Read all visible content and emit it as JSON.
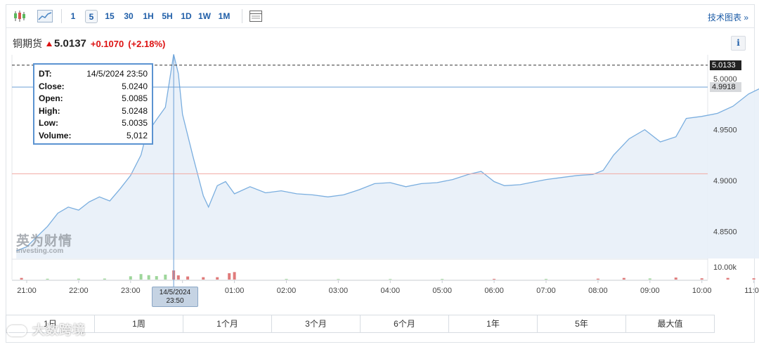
{
  "toolbar": {
    "intervals": [
      "1",
      "5",
      "15",
      "30",
      "1H",
      "5H",
      "1D",
      "1W",
      "1M"
    ],
    "active_interval": "5",
    "tech_chart_label": "技术图表 »"
  },
  "quote": {
    "name": "铜期货",
    "price": "5.0137",
    "change": "+0.1070",
    "change_pct": "(+2.18%)"
  },
  "info_label": "i",
  "brand": {
    "cn": "英为财情",
    "en": "Investing.com"
  },
  "tooltip": {
    "rows": [
      {
        "k": "DT:",
        "v": "14/5/2024 23:50"
      },
      {
        "k": "Close:",
        "v": "5.0240"
      },
      {
        "k": "Open:",
        "v": "5.0085"
      },
      {
        "k": "High:",
        "v": "5.0248"
      },
      {
        "k": "Low:",
        "v": "5.0035"
      },
      {
        "k": "Volume:",
        "v": "5,012"
      }
    ]
  },
  "crosshair_time": {
    "date": "14/5/2024",
    "time": "23:50"
  },
  "price_flags": {
    "last": "5.0133",
    "cursor": "4.9918"
  },
  "ranges": [
    "1日",
    "1周",
    "1个月",
    "3个月",
    "6个月",
    "1年",
    "5年",
    "最大值"
  ],
  "watermark": "大数跨境",
  "colors": {
    "line": "#7aaedf",
    "area": "#e8f0f8",
    "up_volume": "#e07b7b",
    "down_volume": "#9ed69b",
    "accent": "#1f5ea8",
    "negative": "#d11111"
  },
  "chart_data": {
    "type": "area",
    "title": "",
    "xlabel": "",
    "ylabel": "",
    "x_ticks": [
      "21:00",
      "22:00",
      "23:00",
      "00:00",
      "01:00",
      "02:00",
      "03:00",
      "04:00",
      "05:00",
      "06:00",
      "07:00",
      "08:00",
      "09:00",
      "10:00",
      "11:00"
    ],
    "y_ticks": [
      "4.8500",
      "4.9000",
      "4.9500",
      "5.0000"
    ],
    "ylim": [
      4.8235,
      5.0235
    ],
    "volume_axis_label": "10.00k",
    "volume_max": 10000,
    "reference_lines": {
      "last_price": 5.0133,
      "cursor_price": 4.9918,
      "previous_close": 4.9067
    },
    "series": [
      {
        "points": [
          [
            20.8,
            4.831
          ],
          [
            21.0,
            4.835
          ],
          [
            21.2,
            4.845
          ],
          [
            21.4,
            4.855
          ],
          [
            21.6,
            4.868
          ],
          [
            21.8,
            4.874
          ],
          [
            22.0,
            4.871
          ],
          [
            22.2,
            4.879
          ],
          [
            22.4,
            4.884
          ],
          [
            22.6,
            4.88
          ],
          [
            22.8,
            4.892
          ],
          [
            23.0,
            4.905
          ],
          [
            23.2,
            4.925
          ],
          [
            23.3,
            4.945
          ],
          [
            23.5,
            4.96
          ],
          [
            23.67,
            4.972
          ],
          [
            23.83,
            5.024
          ],
          [
            23.92,
            5.005
          ],
          [
            24.0,
            4.965
          ],
          [
            24.2,
            4.924
          ],
          [
            24.4,
            4.885
          ],
          [
            24.5,
            4.874
          ],
          [
            24.67,
            4.895
          ],
          [
            24.83,
            4.899
          ],
          [
            25.0,
            4.887
          ],
          [
            25.3,
            4.894
          ],
          [
            25.6,
            4.888
          ],
          [
            25.9,
            4.89
          ],
          [
            26.2,
            4.887
          ],
          [
            26.5,
            4.886
          ],
          [
            26.8,
            4.884
          ],
          [
            27.1,
            4.886
          ],
          [
            27.4,
            4.891
          ],
          [
            27.7,
            4.897
          ],
          [
            28.0,
            4.898
          ],
          [
            28.3,
            4.894
          ],
          [
            28.6,
            4.897
          ],
          [
            28.9,
            4.898
          ],
          [
            29.2,
            4.901
          ],
          [
            29.5,
            4.906
          ],
          [
            29.75,
            4.909
          ],
          [
            30.0,
            4.899
          ],
          [
            30.2,
            4.895
          ],
          [
            30.5,
            4.896
          ],
          [
            30.8,
            4.899
          ],
          [
            31.0,
            4.901
          ],
          [
            31.3,
            4.903
          ],
          [
            31.6,
            4.905
          ],
          [
            31.9,
            4.906
          ],
          [
            32.1,
            4.91
          ],
          [
            32.3,
            4.925
          ],
          [
            32.6,
            4.941
          ],
          [
            32.9,
            4.95
          ],
          [
            33.2,
            4.938
          ],
          [
            33.5,
            4.943
          ],
          [
            33.7,
            4.961
          ],
          [
            34.0,
            4.963
          ],
          [
            34.3,
            4.966
          ],
          [
            34.6,
            4.973
          ],
          [
            34.9,
            4.985
          ],
          [
            35.1,
            4.99
          ],
          [
            35.3,
            4.996
          ],
          [
            35.5,
            5.001
          ],
          [
            35.75,
            5.011
          ],
          [
            35.9,
            5.013
          ]
        ]
      }
    ],
    "volume": [
      {
        "t": 20.9,
        "v": 900,
        "up": true
      },
      {
        "t": 21.4,
        "v": 450,
        "up": false
      },
      {
        "t": 22.0,
        "v": 500,
        "up": false
      },
      {
        "t": 22.5,
        "v": 550,
        "up": false
      },
      {
        "t": 23.0,
        "v": 1800,
        "up": false
      },
      {
        "t": 23.2,
        "v": 3000,
        "up": false
      },
      {
        "t": 23.35,
        "v": 2400,
        "up": false
      },
      {
        "t": 23.5,
        "v": 1900,
        "up": false
      },
      {
        "t": 23.67,
        "v": 2700,
        "up": false
      },
      {
        "t": 23.83,
        "v": 5012,
        "up": true
      },
      {
        "t": 23.92,
        "v": 2300,
        "up": true
      },
      {
        "t": 24.1,
        "v": 1700,
        "up": true
      },
      {
        "t": 24.4,
        "v": 1300,
        "up": true
      },
      {
        "t": 24.67,
        "v": 1300,
        "up": true
      },
      {
        "t": 24.9,
        "v": 3500,
        "up": true
      },
      {
        "t": 25.0,
        "v": 4100,
        "up": true
      },
      {
        "t": 26.0,
        "v": 350,
        "up": false
      },
      {
        "t": 27.0,
        "v": 300,
        "up": false
      },
      {
        "t": 28.0,
        "v": 300,
        "up": false
      },
      {
        "t": 29.0,
        "v": 350,
        "up": false
      },
      {
        "t": 30.0,
        "v": 400,
        "up": true
      },
      {
        "t": 31.0,
        "v": 350,
        "up": false
      },
      {
        "t": 32.0,
        "v": 500,
        "up": true
      },
      {
        "t": 32.5,
        "v": 900,
        "up": true
      },
      {
        "t": 33.0,
        "v": 600,
        "up": false
      },
      {
        "t": 33.5,
        "v": 1100,
        "up": true
      },
      {
        "t": 34.0,
        "v": 700,
        "up": true
      },
      {
        "t": 34.5,
        "v": 900,
        "up": true
      },
      {
        "t": 35.0,
        "v": 700,
        "up": true
      },
      {
        "t": 35.5,
        "v": 1200,
        "up": true
      }
    ]
  }
}
